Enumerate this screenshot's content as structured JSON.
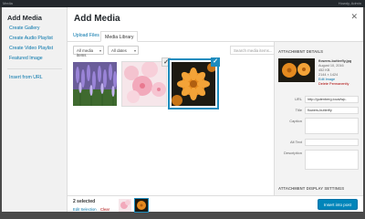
{
  "adminbar": {
    "left": "Media",
    "right": "Howdy, Admin"
  },
  "menu": {
    "title": "Add Media",
    "items": [
      "Create Gallery",
      "Create Audio Playlist",
      "Create Video Playlist",
      "Featured Image",
      "Insert from URL"
    ]
  },
  "modal": {
    "title": "Add Media",
    "close_icon": "close-icon"
  },
  "tabs": {
    "upload": "Upload Files",
    "library": "Media Library"
  },
  "filters": {
    "type": "All media items",
    "dates": "All dates",
    "search_placeholder": "Search media items..."
  },
  "library": {
    "items": [
      {
        "name": "lavender",
        "selected": false
      },
      {
        "name": "pink-blossom",
        "selected": true
      },
      {
        "name": "flowers-butterfly",
        "selected": true,
        "current": true
      }
    ]
  },
  "details": {
    "heading": "ATTACHMENT DETAILS",
    "filename": "flowers-butterfly.jpg",
    "date": "August 10, 2016",
    "size": "452 KB",
    "dimensions": "2144 × 1424",
    "edit": "Edit Image",
    "delete": "Delete Permanently",
    "labels": {
      "url": "URL",
      "title": "Title",
      "caption": "Caption",
      "alt": "Alt Text",
      "description": "Description"
    },
    "url": "http://gutenberg.local/wp-",
    "title": "flowers-butterfly",
    "caption": "",
    "alt": "",
    "description": "",
    "display_heading": "ATTACHMENT DISPLAY SETTINGS"
  },
  "toolbar": {
    "count": "2 selected",
    "edit_selection": "Edit Selection",
    "clear": "Clear",
    "insert": "Insert into post"
  },
  "colors": {
    "accent": "#0073aa",
    "selection": "#1e8cbe",
    "button": "#0085ba"
  }
}
